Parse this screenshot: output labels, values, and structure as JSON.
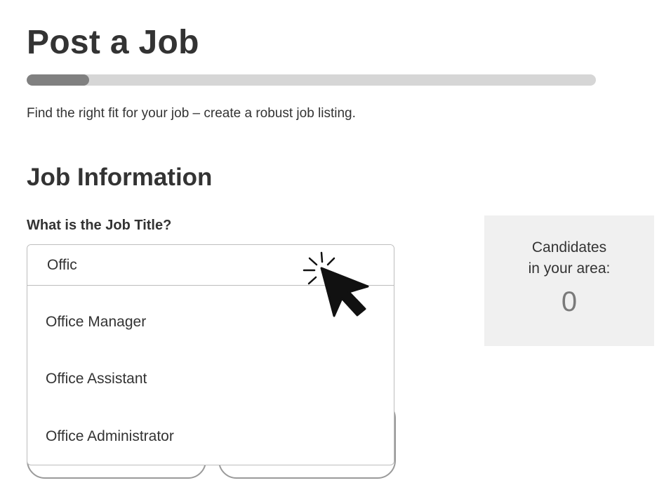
{
  "header": {
    "title": "Post a Job",
    "progress_fraction": 0.11,
    "subtitle": "Find the right fit for your job – create a robust job listing."
  },
  "job_information": {
    "heading": "Job Information",
    "job_title_label": "What is the Job Title?",
    "job_title_value": "Offic",
    "suggestions": [
      "Office Manager",
      "Office Assistant",
      "Office Administrator"
    ]
  },
  "candidates": {
    "label_line1": "Candidates",
    "label_line2": "in your area:",
    "count": "0"
  },
  "icons": {
    "cursor": "click-pointer-icon"
  },
  "colors": {
    "text": "#333333",
    "progress_fill": "#808080",
    "progress_track": "#d6d6d6",
    "panel_bg": "#f0f0f0",
    "count_text": "#7a7a7a"
  }
}
